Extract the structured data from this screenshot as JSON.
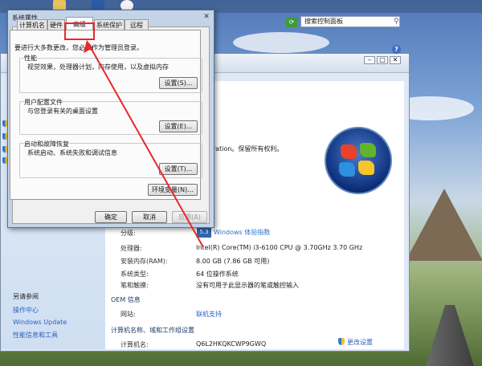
{
  "dialog": {
    "title": "系统属性",
    "close_glyph": "✕",
    "tabs": [
      "计算机名",
      "硬件",
      "高级",
      "系统保护",
      "远程"
    ],
    "admin_note": "要进行大多数更改，您必须作为管理员登录。",
    "performance": {
      "title": "性能",
      "desc": "视觉效果，处理器计划，内存使用，以及虚拟内存",
      "button": "设置(S)..."
    },
    "user_profiles": {
      "title": "用户配置文件",
      "desc": "与您登录有关的桌面设置",
      "button": "设置(E)..."
    },
    "startup_recovery": {
      "title": "启动和故障恢复",
      "desc": "系统启动、系统失败和调试信息",
      "button": "设置(T)..."
    },
    "env_button": "环境变量(N)...",
    "ok": "确定",
    "cancel": "取消",
    "apply": "应用(A)"
  },
  "system_window": {
    "search_placeholder": "搜索控制面板",
    "help": "?",
    "copyright_tail": "oration。保留所有权利。",
    "rating_badge": "5.3",
    "rating_label": "分级:",
    "rating_link": "Windows 体验指数",
    "specs": [
      {
        "label": "处理器:",
        "value": "Intel(R) Core(TM) i3-6100 CPU @ 3.70GHz   3.70 GHz"
      },
      {
        "label": "安装内存(RAM):",
        "value": "8.00 GB (7.86 GB 可用)"
      },
      {
        "label": "系统类型:",
        "value": "64 位操作系统"
      },
      {
        "label": "笔和触摸:",
        "value": "没有可用于此显示器的笔或触控输入"
      }
    ],
    "oem_head": "OEM 信息",
    "website_label": "网站:",
    "website_link": "联机支持",
    "computer_head": "计算机名称、域和工作组设置",
    "computer_label": "计算机名:",
    "computer_value": "Q6L2HKQKCWP9GWQ",
    "change_settings": "更改设置",
    "see_also": "另请参阅",
    "side_links": [
      "操作中心",
      "Windows Update",
      "性能信息和工具"
    ]
  },
  "colors": {
    "highlight": "#e8282a",
    "link": "#2a63c0"
  }
}
